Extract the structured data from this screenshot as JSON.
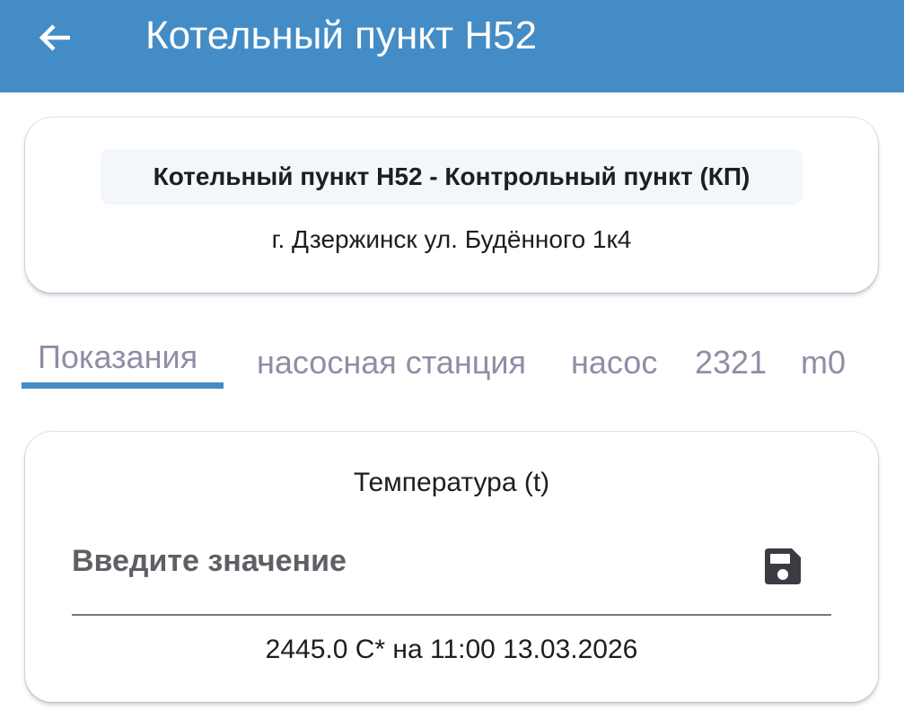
{
  "appbar": {
    "title": "Котельный пункт Н52",
    "back_icon": "arrow-left-icon",
    "background": "#448cc5"
  },
  "station": {
    "name": "Котельный пункт Н52 - Контрольный пункт (КП)",
    "address": "г. Дзержинск ул. Будённого 1к4"
  },
  "tabs": [
    {
      "label": "Показания",
      "active": true
    },
    {
      "label": "насосная станция",
      "active": false
    },
    {
      "label": "насос",
      "active": false
    },
    {
      "label": "2321",
      "active": false
    },
    {
      "label": "m0",
      "active": false
    }
  ],
  "reading": {
    "title": "Температура (t)",
    "input_placeholder": "Введите значение",
    "input_value": "",
    "save_icon": "save-icon",
    "last_value": "2445.0 С* на 11:00 13.03.2026"
  },
  "colors": {
    "accent": "#448cc5",
    "tab_text": "#8e8ea6",
    "text": "#1d1d22"
  }
}
